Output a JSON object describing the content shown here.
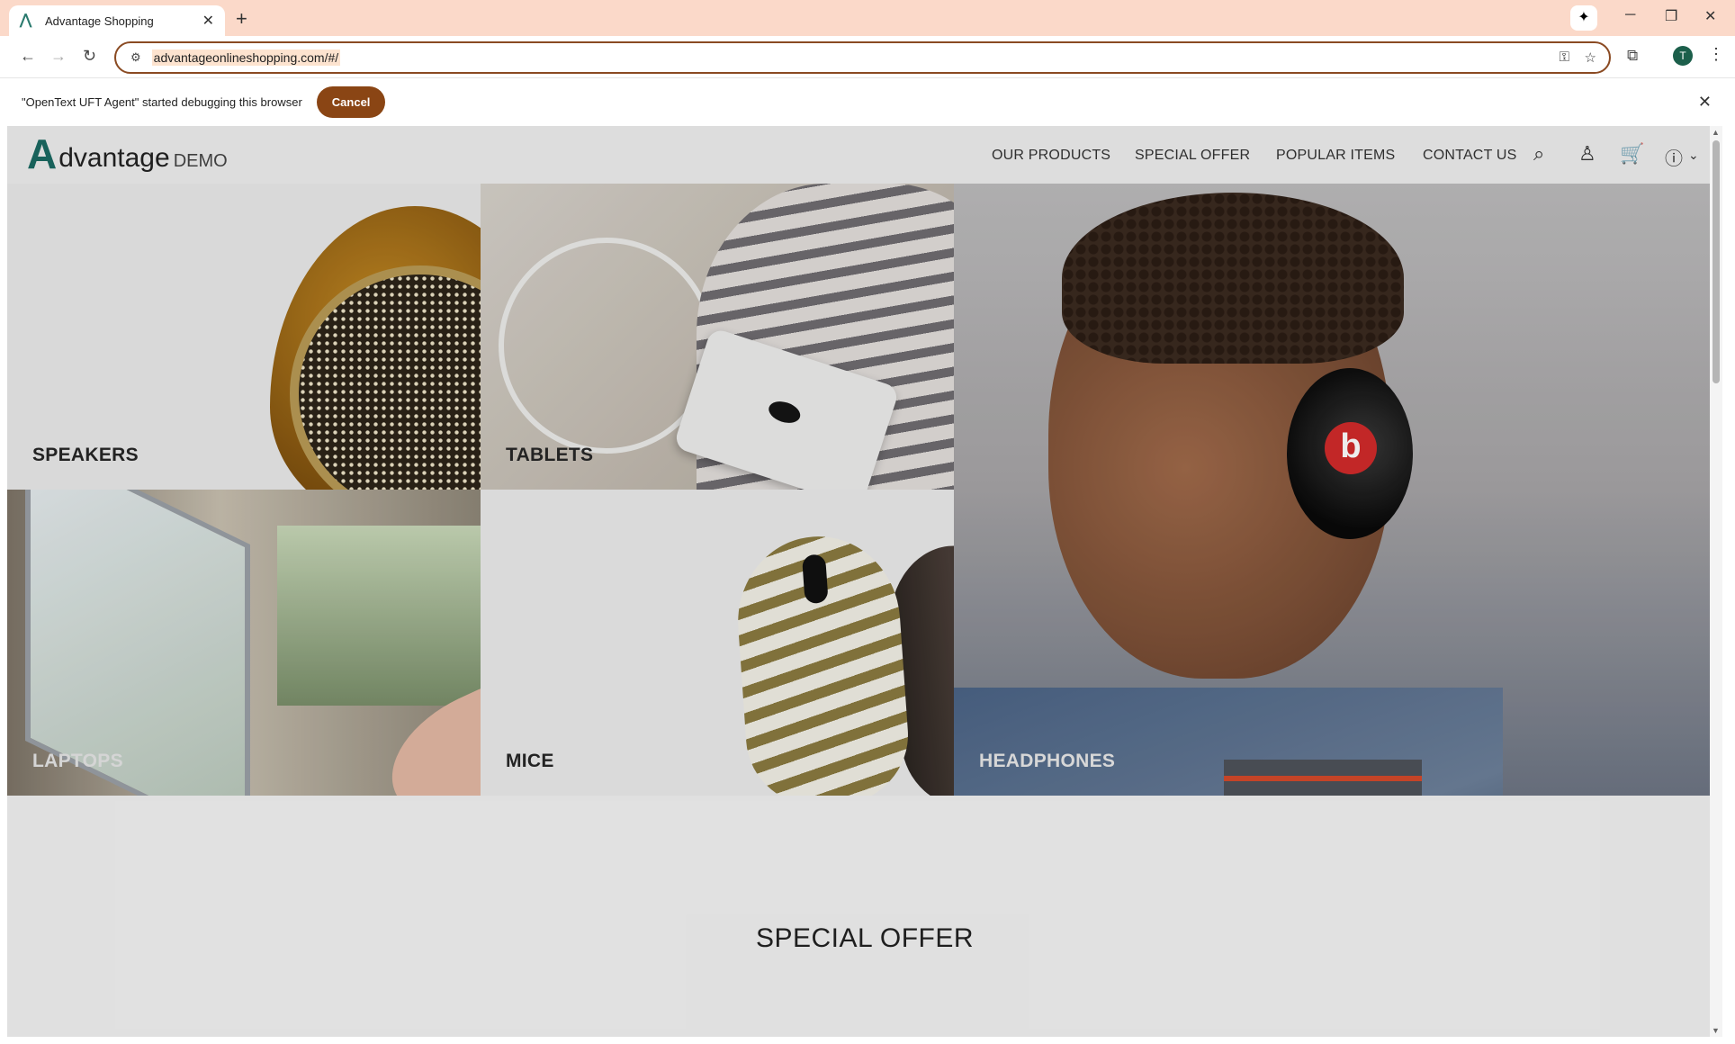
{
  "browser": {
    "tab_title": "Advantage Shopping",
    "url": "advantageonlineshopping.com/#/",
    "profile_initial": "T",
    "accent_color": "#fbd9c9"
  },
  "infobar": {
    "message": "\"OpenText UFT Agent\" started debugging this browser",
    "cancel_label": "Cancel"
  },
  "site": {
    "logo_mark": "A",
    "logo_word": "dvantage",
    "logo_suffix": "DEMO",
    "nav": [
      "OUR PRODUCTS",
      "SPECIAL OFFER",
      "POPULAR ITEMS",
      "CONTACT US"
    ],
    "categories": [
      "SPEAKERS",
      "TABLETS",
      "HEADPHONES",
      "LAPTOPS",
      "MICE"
    ],
    "section_title": "SPECIAL OFFER",
    "brand_color": "#1a6a62"
  },
  "icons": [
    "search-icon",
    "user-icon",
    "cart-icon",
    "help-icon",
    "chevron-down-icon"
  ]
}
